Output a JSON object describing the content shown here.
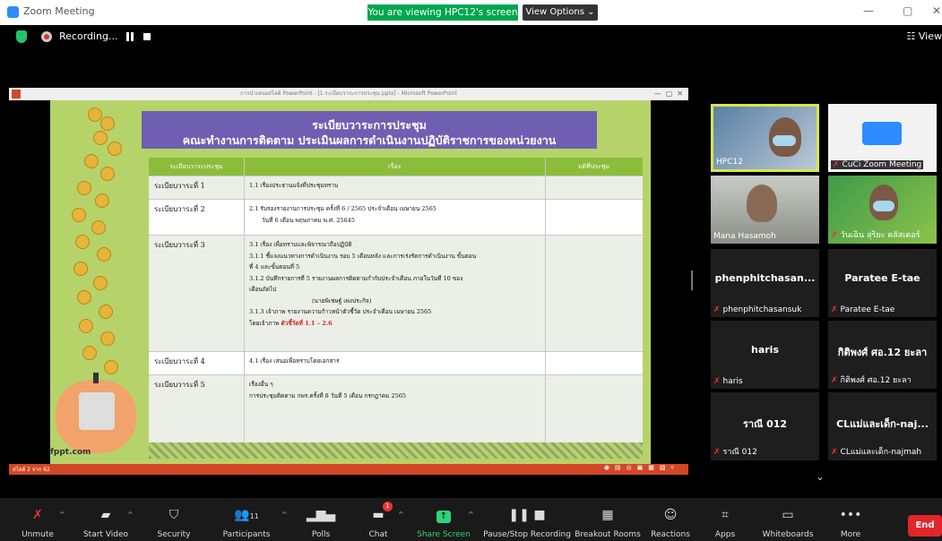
{
  "window": {
    "app_title": "Zoom Meeting"
  },
  "share_banner": {
    "text": "You are viewing HPC12's screen",
    "view_options": "View Options ⌄"
  },
  "recording": {
    "label": "Recording..."
  },
  "view_button": "☷ View",
  "slide_window": {
    "title": "การนำเสนอสไลด์ PowerPoint - [1.ระเบียบวาระการประชุม.pptx] - Microsoft PowerPoint"
  },
  "slide": {
    "heading_line1": "ระเบียบวาระการประชุม",
    "heading_line2": "คณะทำงานการติดตาม ประเมินผลการดำเนินงานปฏิบัติราชการของหน่วยงาน",
    "columns": [
      "ระเบียบวาระประชุม",
      "เรื่อง",
      "มติที่ประชุม"
    ],
    "rows": [
      {
        "agenda": "ระเบียบวาระที่ 1",
        "lines": [
          "1.1 เรื่องประธานแจ้งที่ประชุมทราบ"
        ]
      },
      {
        "agenda": "ระเบียบวาระที่ 2",
        "lines": [
          "2.1 รับรองรายงานการประชุม ครั้งที่ 6 / 2565 ประจำเดือน เมษายน 2565",
          "วันที่ 6 เดือน พฤษภาคม พ.ศ. 25645"
        ]
      },
      {
        "agenda": "ระเบียบวาระที่ 3",
        "lines": [
          "3.1 เรื่อง เพื่อทราบและพิจารณาถือปฏิบัติ",
          "3.1.1 ชี้แจงแนวทางการดำเนินงาน รอบ 5 เดือนหลัง และการเร่งรัดการดำเนินงาน ขั้นตอน",
          "ที่ 4 และขั้นตอนที่ 5",
          "3.1.2 บันทึกรายการที่ 5 รายงานผลการติดตามกำกับประจำเดือน ภายในวันที่ 10 ของ",
          "เดือนถัดไป",
          "(นายพิเชษฐ์ เพ่งประกิจ)",
          "3.1.3 เจ้าภาพ รายงานความก้าวหน้าตัวชี้วัด ประจำเดือน เมษายน 2565"
        ],
        "highlight_prefix": "โดยเจ้าภาพ ",
        "highlight": "ตัวชี้วัดที่ 1.1 – 2.6"
      },
      {
        "agenda": "ระเบียบวาระที่ 4",
        "lines": [
          "4.1 เรื่อง เสนอเพื่อทราบโดยเอกสาร"
        ]
      },
      {
        "agenda": "ระเบียบวาระที่ 5",
        "lines": [
          "เรื่องอื่น ๆ",
          "การประชุมติดตาม กพร.ครั้งที่ 8 วันที่ 5 เดือน กรกฎาคม 2565"
        ]
      }
    ],
    "footer_brand": "fppt.com",
    "status_left": "สไลด์ 2 จาก 62"
  },
  "participants": [
    {
      "tag": "HPC12",
      "has_video": true,
      "active": true
    },
    {
      "tag": "CuCi Zoom Meeting",
      "has_video": true,
      "active": false
    },
    {
      "tag": "Mana Hasamoh",
      "has_video": true,
      "active": false
    },
    {
      "tag": "วันเฉิน สุริยะ คลัสเตอร์",
      "has_video": true,
      "active": false
    },
    {
      "big": "phenphitchasan...",
      "tag": "phenphitchasansuk",
      "has_video": false
    },
    {
      "big": "Paratee E-tae",
      "tag": "Paratee E-tae",
      "has_video": false
    },
    {
      "big": "haris",
      "tag": "haris",
      "has_video": false
    },
    {
      "big": "กิติพงศ์ ศอ.12 ยะลา",
      "tag": "กิติพงศ์ ศอ.12 ยะลา",
      "has_video": false
    },
    {
      "big": "ราณี 012",
      "tag": "ราณี 012",
      "has_video": false
    },
    {
      "big": "CLแม่และเด็ก-naj...",
      "tag": "CLแม่และเด็ก-najmah",
      "has_video": false
    }
  ],
  "toolbar": {
    "unmute": "Unmute",
    "start_video": "Start Video",
    "security": "Security",
    "participants": "Participants",
    "participant_count": "11",
    "polls": "Polls",
    "chat": "Chat",
    "chat_badge": "1",
    "share_screen": "Share Screen",
    "pause_recording": "Pause/Stop Recording",
    "breakout": "Breakout Rooms",
    "reactions": "Reactions",
    "apps": "Apps",
    "whiteboards": "Whiteboards",
    "more": "More",
    "end": "End"
  },
  "colors": {
    "share_green": "#00a650",
    "slide_bg": "#b6d36a",
    "heading_purple": "#6f5fb3",
    "table_header": "#8bbc3a",
    "end_red": "#e0262b"
  }
}
